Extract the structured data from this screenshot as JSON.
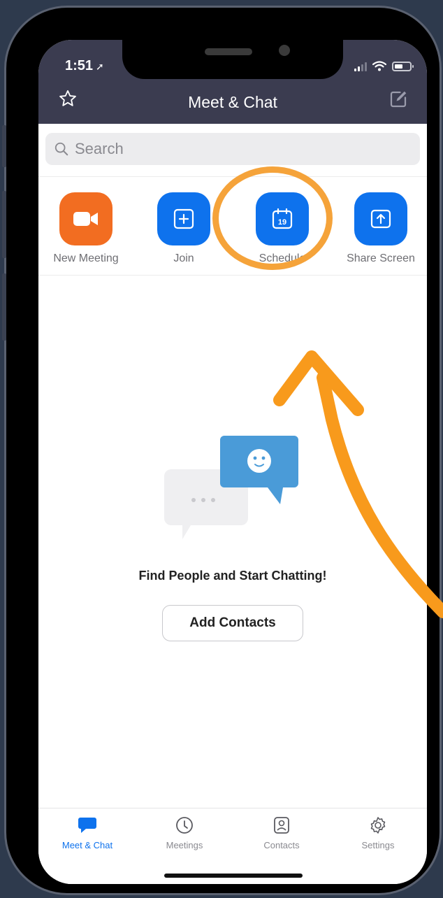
{
  "status_bar": {
    "time": "1:51",
    "location_arrow": "location-arrow-icon"
  },
  "header": {
    "title": "Meet & Chat",
    "left_icon": "star-icon",
    "right_icon": "compose-icon"
  },
  "search": {
    "placeholder": "Search"
  },
  "actions": [
    {
      "label": "New Meeting",
      "icon": "video-camera-icon",
      "color": "#f26d21"
    },
    {
      "label": "Join",
      "icon": "plus-icon",
      "color": "#0e72ed"
    },
    {
      "label": "Schedule",
      "icon": "calendar-icon",
      "calendar_day": "19",
      "color": "#0e72ed"
    },
    {
      "label": "Share Screen",
      "icon": "share-screen-icon",
      "color": "#0e72ed"
    }
  ],
  "empty_state": {
    "title": "Find People and Start Chatting!",
    "button_label": "Add Contacts"
  },
  "tabs": [
    {
      "label": "Meet & Chat",
      "icon": "chat-bubble-icon",
      "active": true
    },
    {
      "label": "Meetings",
      "icon": "clock-icon",
      "active": false
    },
    {
      "label": "Contacts",
      "icon": "contact-card-icon",
      "active": false
    },
    {
      "label": "Settings",
      "icon": "gear-icon",
      "active": false
    }
  ],
  "colors": {
    "accent": "#0e72ed",
    "orange": "#f26d21",
    "annotation": "#f5a33a",
    "header_bg": "#3b3c50"
  }
}
